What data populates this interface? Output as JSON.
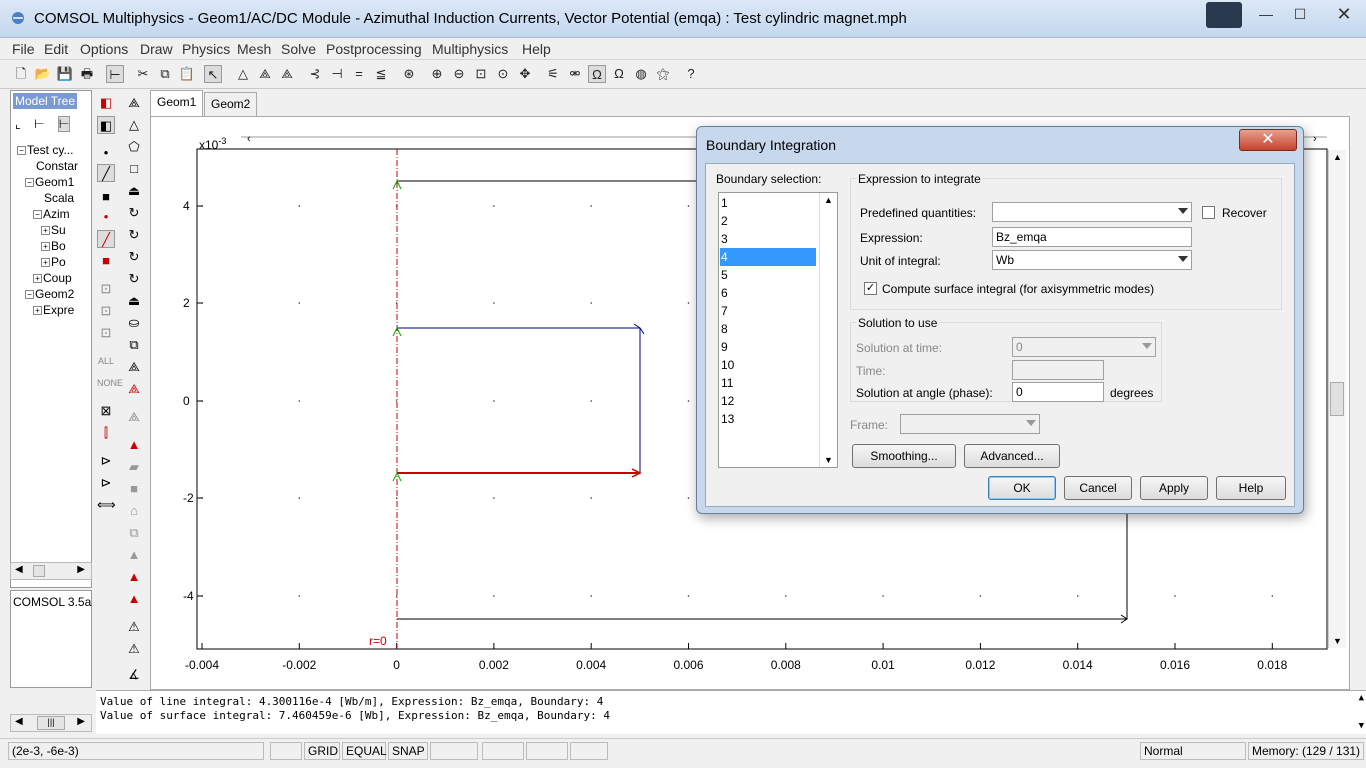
{
  "window": {
    "title": "COMSOL Multiphysics - Geom1/AC/DC Module - Azimuthal Induction Currents, Vector Potential (emqa) : Test cylindric magnet.mph",
    "min_label": "—",
    "max_label": "☐",
    "close_label": "✕"
  },
  "menu": [
    "File",
    "Edit",
    "Options",
    "Draw",
    "Physics",
    "Mesh",
    "Solve",
    "Postprocessing",
    "Multiphysics",
    "Help"
  ],
  "tree": {
    "title": "Model Tree",
    "items": [
      {
        "label": "Test cy...",
        "indent": 0,
        "exp": "−"
      },
      {
        "label": "Constar",
        "indent": 1,
        "exp": ""
      },
      {
        "label": "Geom1",
        "indent": 1,
        "exp": "−"
      },
      {
        "label": "Scala",
        "indent": 2,
        "exp": ""
      },
      {
        "label": "Azim",
        "indent": 2,
        "exp": "−"
      },
      {
        "label": "Su",
        "indent": 3,
        "exp": "+"
      },
      {
        "label": "Bo",
        "indent": 3,
        "exp": "+"
      },
      {
        "label": "Po",
        "indent": 3,
        "exp": "+"
      },
      {
        "label": "Coup",
        "indent": 2,
        "exp": "+"
      },
      {
        "label": "Geom2",
        "indent": 1,
        "exp": "−"
      },
      {
        "label": "Expre",
        "indent": 2,
        "exp": "+"
      }
    ],
    "info": "COMSOL 3.5a"
  },
  "tabs": [
    {
      "label": "Geom1",
      "active": true
    },
    {
      "label": "Geom2",
      "active": false
    }
  ],
  "plot": {
    "y_exponent": "x10",
    "y_exponent_power": "-3",
    "y_ticks": [
      "4",
      "2",
      "0",
      "-2",
      "-4"
    ],
    "x_ticks": [
      "-0.004",
      "-0.002",
      "0",
      "0.002",
      "0.004",
      "0.006",
      "0.008",
      "0.01",
      "0.012",
      "0.014",
      "0.016",
      "0.018"
    ],
    "axis_label": "r=0",
    "colors": {
      "line": "#000080",
      "selected": "#cc0000",
      "axis": "#cc0000",
      "black": "#000000"
    }
  },
  "log": [
    "Value of line integral: 4.300116e-4 [Wb/m], Expression: Bz_emqa, Boundary: 4",
    "Value of surface integral: 7.460459e-6 [Wb], Expression: Bz_emqa, Boundary: 4"
  ],
  "status": {
    "coords": "(2e-3, -6e-3)",
    "grid": "GRID",
    "equal": "EQUAL",
    "snap": "SNAP",
    "mode": "Normal",
    "memory": "Memory: (129 / 131)"
  },
  "dialog": {
    "title": "Boundary Integration",
    "close": "✕",
    "boundary_label": "Boundary selection:",
    "boundaries": [
      "1",
      "2",
      "3",
      "4",
      "5",
      "6",
      "7",
      "8",
      "9",
      "10",
      "11",
      "12",
      "13"
    ],
    "selected_boundary": "4",
    "expr_group": "Expression to integrate",
    "predefined_label": "Predefined quantities:",
    "predefined_value": "",
    "recover_label": "Recover",
    "expression_label": "Expression:",
    "expression_value": "Bz_emqa",
    "unit_label": "Unit of integral:",
    "unit_value": "Wb",
    "compute_label": "Compute surface integral (for axisymmetric modes)",
    "compute_checked": "✓",
    "solution_group": "Solution to use",
    "sol_time_label": "Solution at time:",
    "sol_time_value": "0",
    "time_label": "Time:",
    "time_value": "",
    "angle_label": "Solution at angle (phase):",
    "angle_value": "0",
    "angle_unit": "degrees",
    "frame_label": "Frame:",
    "frame_value": "",
    "smoothing": "Smoothing...",
    "advanced": "Advanced...",
    "ok": "OK",
    "cancel": "Cancel",
    "apply": "Apply",
    "help": "Help"
  }
}
